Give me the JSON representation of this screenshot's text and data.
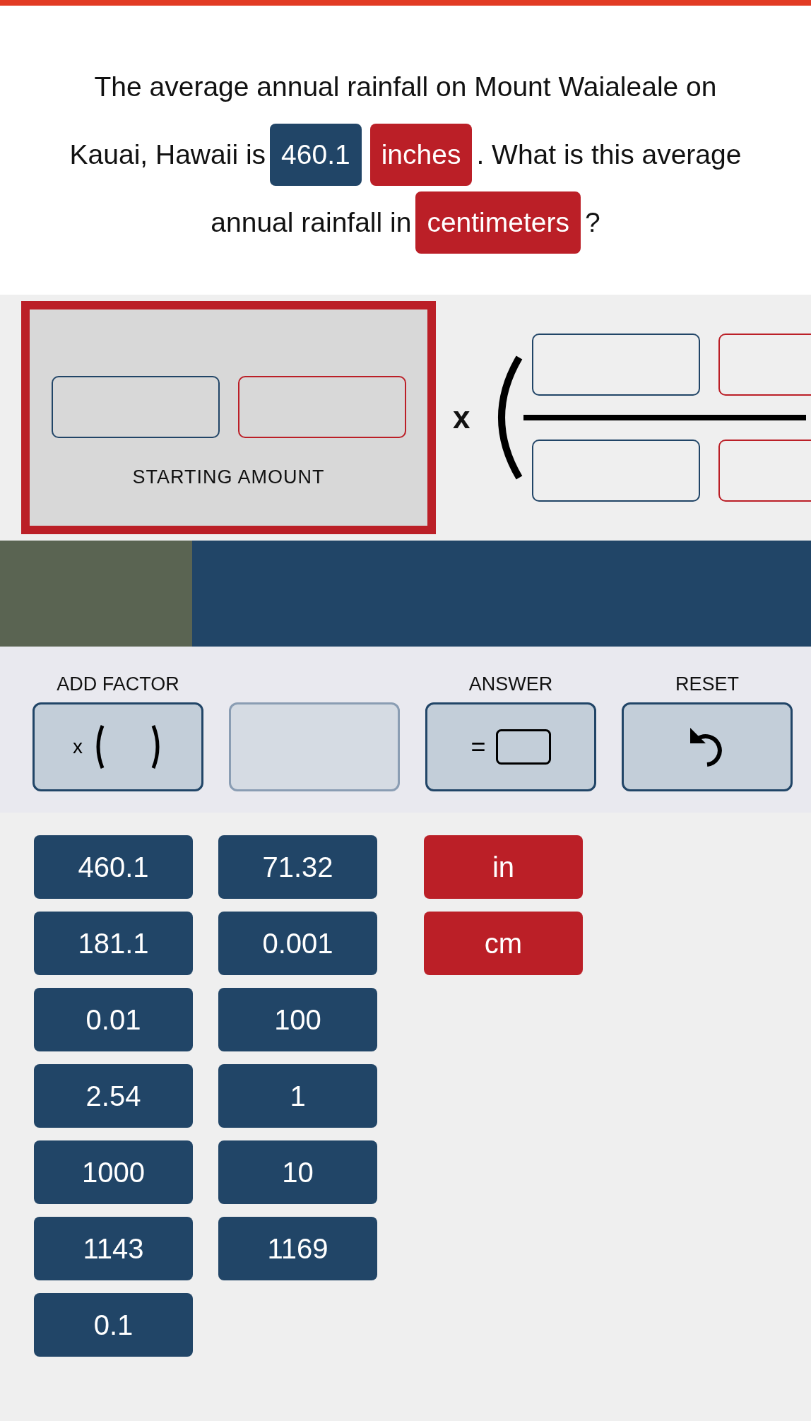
{
  "question": [
    [
      {
        "kind": "text",
        "text": "The average annual rainfall on Mount Waialeale on"
      }
    ],
    [
      {
        "kind": "text",
        "text": "Kauai, Hawaii is"
      },
      {
        "kind": "number",
        "text": "460.1"
      },
      {
        "kind": "unit",
        "text": "inches"
      },
      {
        "kind": "text",
        "text": ". What is this average"
      }
    ],
    [
      {
        "kind": "text",
        "text": "annual rainfall in"
      },
      {
        "kind": "unit",
        "text": "centimeters"
      },
      {
        "kind": "text",
        "text": "?"
      }
    ]
  ],
  "starting_amount": {
    "label": "STARTING AMOUNT"
  },
  "factor": {
    "operator": "x"
  },
  "progress": {
    "level": 0.237
  },
  "toolbar": [
    {
      "kind": "add_factor",
      "label": "ADD FACTOR",
      "symbol": "x",
      "disabled": false
    },
    {
      "kind": "blank",
      "disabled": true
    },
    {
      "kind": "answer",
      "label": "ANSWER",
      "symbol": "=",
      "disabled": false
    },
    {
      "kind": "reset",
      "label": "RESET",
      "disabled": false
    }
  ],
  "tiles": [
    [
      {
        "kind": "number",
        "text": "460.1"
      },
      {
        "kind": "number",
        "text": "181.1"
      },
      {
        "kind": "number",
        "text": "0.01"
      },
      {
        "kind": "number",
        "text": "2.54"
      },
      {
        "kind": "number",
        "text": "1000"
      },
      {
        "kind": "number",
        "text": "1143"
      },
      {
        "kind": "number",
        "text": "0.1"
      }
    ],
    [
      {
        "kind": "number",
        "text": "71.32"
      },
      {
        "kind": "number",
        "text": "0.001"
      },
      {
        "kind": "number",
        "text": "100"
      },
      {
        "kind": "number",
        "text": "1"
      },
      {
        "kind": "number",
        "text": "10"
      },
      {
        "kind": "number",
        "text": "1169"
      }
    ],
    [
      {
        "kind": "unit",
        "text": "in"
      },
      {
        "kind": "unit",
        "text": "cm"
      }
    ]
  ]
}
